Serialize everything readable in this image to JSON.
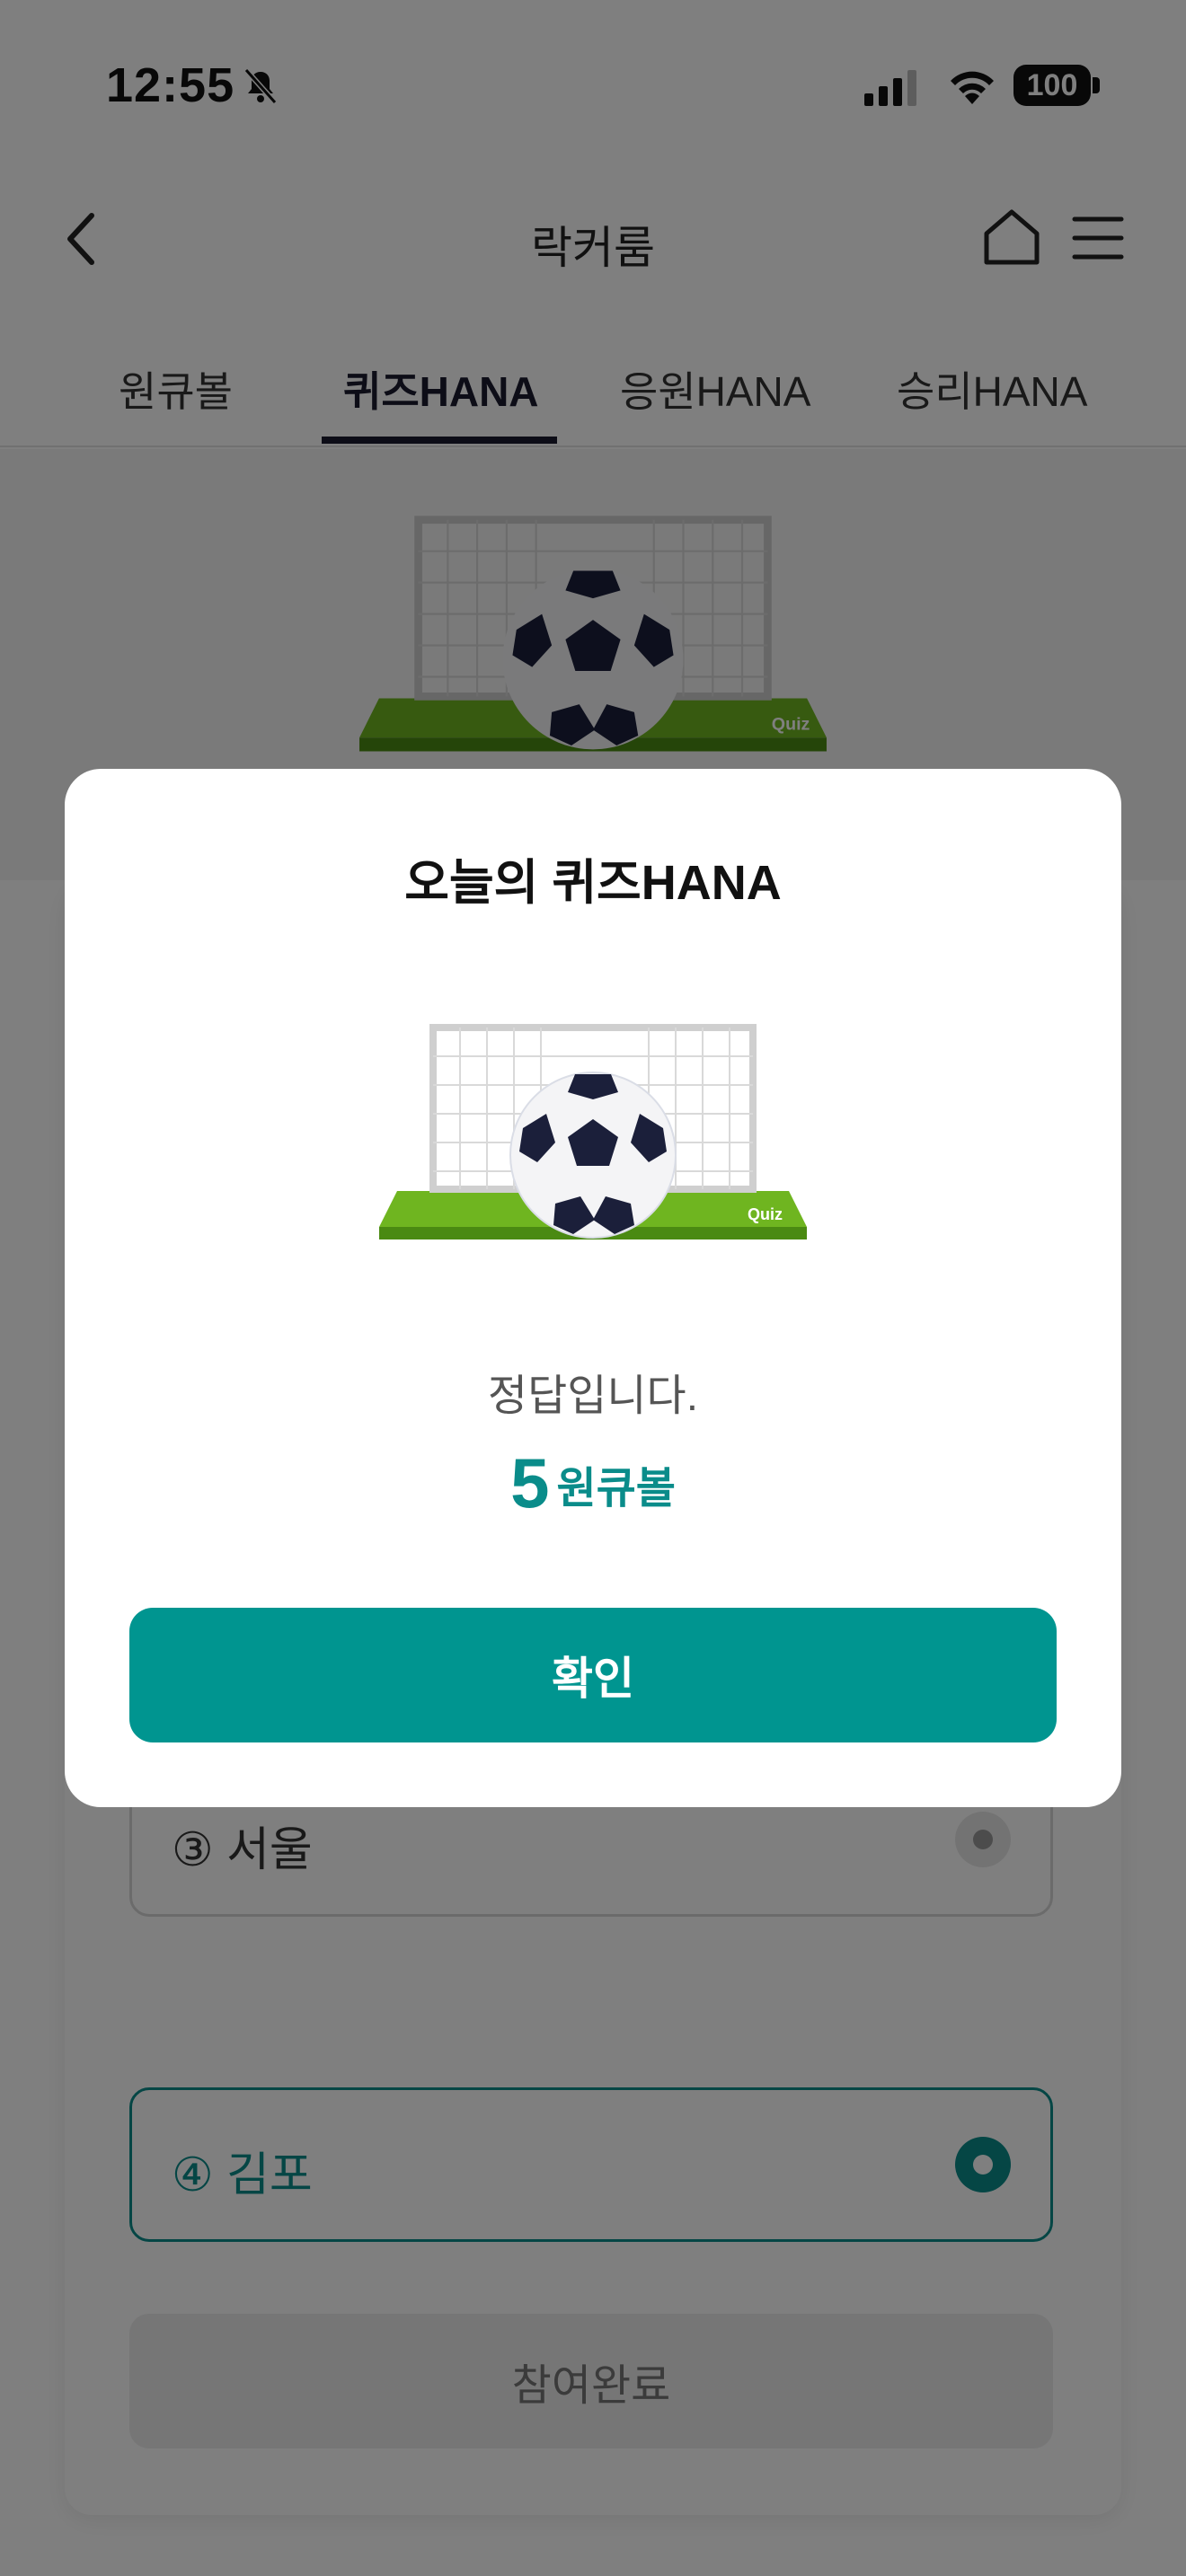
{
  "status_bar": {
    "time": "12:55",
    "battery": "100"
  },
  "header": {
    "title": "락커룸"
  },
  "tabs": [
    {
      "label": "원큐볼"
    },
    {
      "label": "퀴즈HANA"
    },
    {
      "label": "응원HANA"
    },
    {
      "label": "승리HANA"
    }
  ],
  "quiz": {
    "illustration_label": "Quiz",
    "options": [
      {
        "label": "③ 서울",
        "selected": false
      },
      {
        "label": "④ 김포",
        "selected": true
      }
    ],
    "submit_label": "참여완료"
  },
  "modal": {
    "title": "오늘의 퀴즈HANA",
    "illustration_label": "Quiz",
    "result_text": "정답입니다.",
    "reward_amount": "5",
    "reward_unit": "원큐볼",
    "confirm_label": "확인"
  },
  "colors": {
    "accent": "#009590",
    "accent_text": "#0a8c8a",
    "tab_active": "#1a1a2e"
  }
}
